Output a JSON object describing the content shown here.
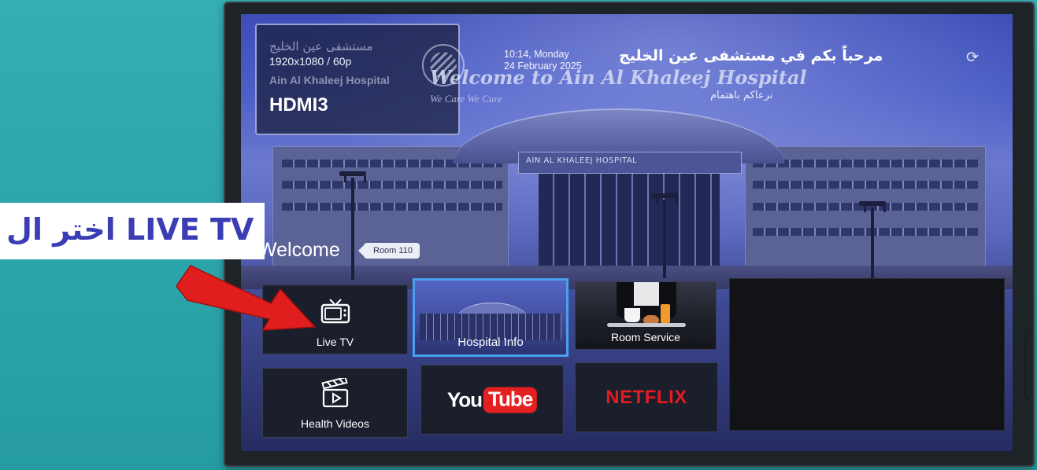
{
  "instruction": {
    "text": "اختر ال LIVE TV"
  },
  "input_info": {
    "resolution": "1920x1080 / 60p",
    "source": "HDMI3",
    "logo_arabic": "مستشفى عين الخليج",
    "logo_english": "Ain Al Khaleej Hospital"
  },
  "header": {
    "time": "10:14, Monday",
    "date": "24 February 2025",
    "welcome_arabic": "مرحباً بكم في مستشفى عين الخليج",
    "welcome_english": "Welcome to Ain Al Khaleej Hospital",
    "tagline_arabic": "نرعاكم باهتمام",
    "tagline_english": "We Care We Cure",
    "building_sign": "AIN AL KHALEEJ HOSPITAL"
  },
  "greeting": {
    "welcome": "Welcome",
    "room": "Room 110"
  },
  "tiles": {
    "live_tv": "Live TV",
    "hospital_info": "Hospital Info",
    "room_service": "Room Service",
    "health_videos": "Health Videos",
    "youtube_you": "You",
    "youtube_tube": "Tube",
    "netflix": "NETFLIX"
  },
  "icons": {
    "refresh": "refresh-icon",
    "tv": "tv-icon",
    "clapperboard": "clapperboard-icon",
    "arrow": "red-arrow-icon"
  },
  "colors": {
    "focus": "#4aa0f0",
    "instruction_text": "#3b3db5",
    "arrow": "#e01e1e",
    "youtube": "#e3201f",
    "netflix": "#e31b23"
  }
}
